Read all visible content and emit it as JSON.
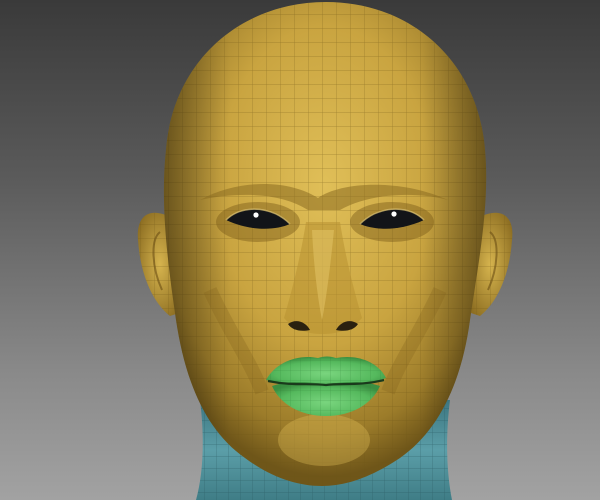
{
  "viewport": {
    "label": "",
    "model": "head-sculpt-polygroups"
  },
  "polygroups": [
    {
      "name": "",
      "color": "#c9a440"
    },
    {
      "name": "",
      "color": "#5bbf63"
    },
    {
      "name": "",
      "color": "#4f8f99"
    }
  ],
  "icons": {
    "model": "head-mesh-icon"
  }
}
